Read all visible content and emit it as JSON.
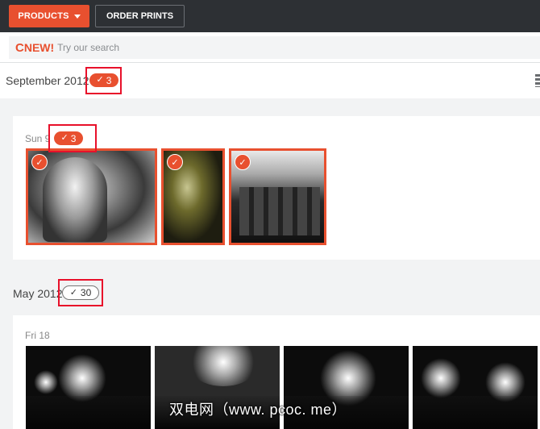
{
  "toolbar": {
    "products_label": "PRODUCTS",
    "order_prints_label": "ORDER PRINTS"
  },
  "search": {
    "new_label": "NEW!",
    "placeholder": "Try our search"
  },
  "sections": [
    {
      "month": "September 2012",
      "selected_count": "3",
      "days": [
        {
          "day": "Sun 9",
          "selected_count": "3",
          "photos": [
            "portrait",
            "street-scene",
            "rooftops"
          ]
        }
      ]
    },
    {
      "month": "May 2012",
      "selected_count": "30",
      "days": [
        {
          "day": "Fri 18",
          "photos": [
            "concert-1",
            "concert-2",
            "concert-3",
            "concert-4"
          ]
        }
      ]
    }
  ],
  "colors": {
    "accent": "#e8502f",
    "topbar": "#2d3034",
    "highlight_box": "#e8102a"
  },
  "icons": {
    "check": "✓",
    "grid": "grid-view-icon"
  },
  "watermark": "双电网（www. pcoc. me）"
}
